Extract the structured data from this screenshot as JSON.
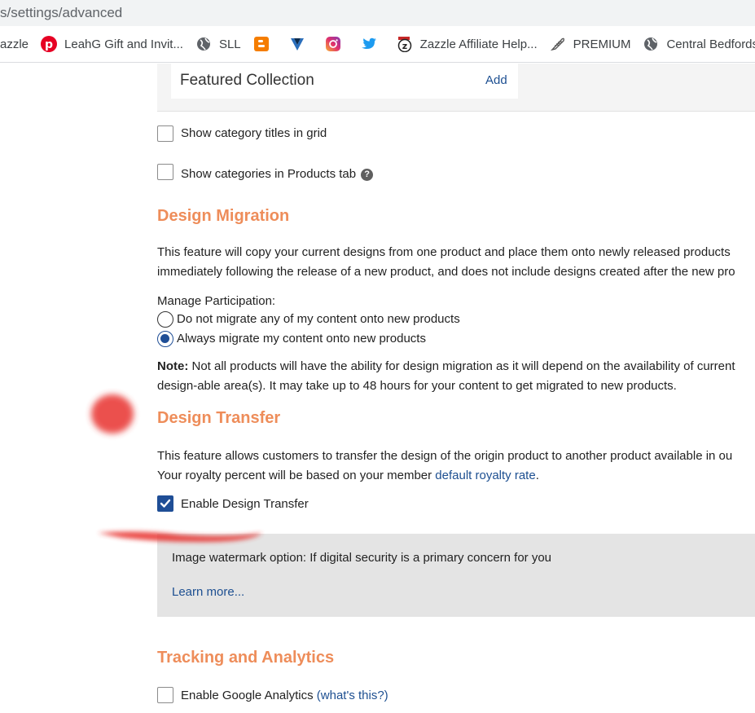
{
  "browser": {
    "url": "s/settings/advanced",
    "bookmarks": [
      {
        "label": "azzle",
        "icon": "zazzle-icon"
      },
      {
        "label": "LeahG Gift and Invit...",
        "icon": "pinterest-icon"
      },
      {
        "label": "SLL",
        "icon": "globe-icon"
      },
      {
        "label": "",
        "icon": "blogger-icon"
      },
      {
        "label": "",
        "icon": "vector-v-icon"
      },
      {
        "label": "",
        "icon": "instagram-icon"
      },
      {
        "label": "",
        "icon": "twitter-icon"
      },
      {
        "label": "Zazzle Affiliate Help...",
        "icon": "zazzle-help-icon"
      },
      {
        "label": "PREMIUM",
        "icon": "feather-icon"
      },
      {
        "label": "Central Bedfords",
        "icon": "globe-icon"
      }
    ]
  },
  "featured": {
    "title": "Featured Collection",
    "add_label": "Add"
  },
  "options": {
    "category_titles": "Show category titles in grid",
    "categories_products_tab": "Show categories in Products tab"
  },
  "migration": {
    "heading": "Design Migration",
    "para1": "This feature will copy your current designs from one product and place them onto newly released products",
    "para2": "immediately following the release of a new product, and does not include designs created after the new pro",
    "manage_label": "Manage Participation:",
    "radio_no": "Do not migrate any of my content onto new products",
    "radio_yes": "Always migrate my content onto new products",
    "note_bold": "Note:",
    "note_text": " Not all products will have the ability for design migration as it will depend on the availability of current",
    "note_line2": "design-able area(s). It may take up to 48 hours for your content to get migrated to new products."
  },
  "transfer": {
    "heading": "Design Transfer",
    "para1": "This feature allows customers to transfer the design of the origin product to another product available in ou",
    "para2_prefix": "Your royalty percent will be based on your member ",
    "para2_link": "default royalty rate",
    "para2_suffix": ".",
    "enable_label": "Enable Design Transfer",
    "watermark_text": "Image watermark option: If digital security is a primary concern for you",
    "learn_more": "Learn more..."
  },
  "tracking": {
    "heading": "Tracking and Analytics",
    "ga_label": "Enable Google Analytics",
    "ga_link": "(what's this?)"
  },
  "colors": {
    "heading_orange": "#ee8d5a",
    "link_blue": "#1d4f91",
    "checkbox_blue": "#1f4e96",
    "scribble_red": "#e8302e"
  }
}
